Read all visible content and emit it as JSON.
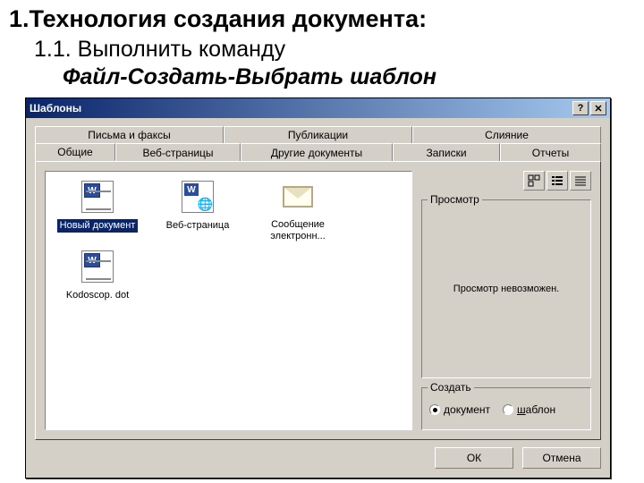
{
  "headings": {
    "h1": "1.Технология создания документа:",
    "h2": "1.1. Выполнить команду",
    "h3": "Файл-Создать-Выбрать шаблон"
  },
  "dialog": {
    "title": "Шаблоны",
    "help_btn": "?",
    "close_btn": "✕",
    "tabs_back": [
      "Письма и факсы",
      "Публикации",
      "Слияние"
    ],
    "tabs_front": [
      "Общие",
      "Веб-страницы",
      "Другие документы",
      "Записки",
      "Отчеты"
    ],
    "items": [
      {
        "label": "Новый документ",
        "icon": "word",
        "selected": true
      },
      {
        "label": "Веб-страница",
        "icon": "web",
        "selected": false
      },
      {
        "label": "Сообщение электронн...",
        "icon": "mail",
        "selected": false
      },
      {
        "label": "Kodoscop. dot",
        "icon": "word",
        "selected": false
      }
    ],
    "preview_title": "Просмотр",
    "preview_text": "Просмотр невозможен.",
    "create_title": "Создать",
    "radio_doc": "документ",
    "radio_tpl": "шаблон",
    "ok": "ОК",
    "cancel": "Отмена"
  }
}
